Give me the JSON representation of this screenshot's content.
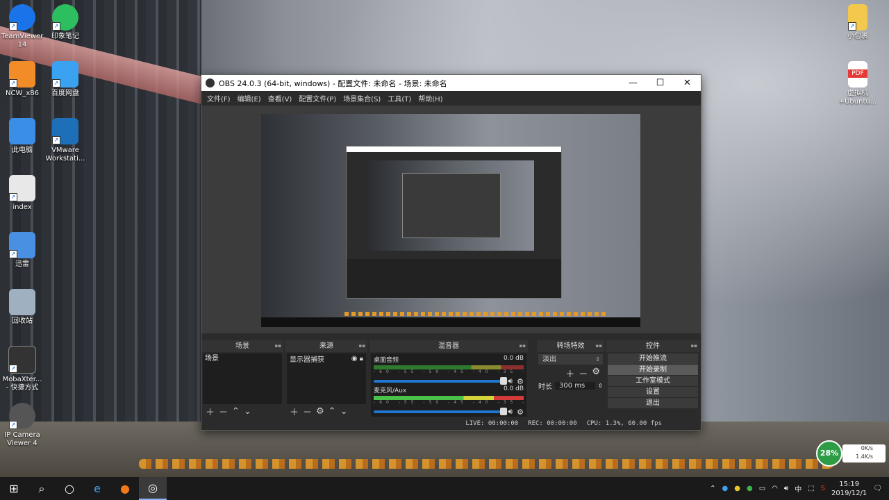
{
  "desktop": {
    "icons_left": [
      {
        "label": "TeamViewer\n14",
        "color": "#1a73e8"
      },
      {
        "label": "NCW_x86",
        "color": "#f28c28"
      },
      {
        "label": "此电脑",
        "color": "#3a8ee6"
      },
      {
        "label": "index",
        "color": "#e8e8e8"
      },
      {
        "label": "迅雷",
        "color": "#4a90e2"
      },
      {
        "label": "回收站",
        "color": "#9fb0c0"
      },
      {
        "label": "MobaXter...\n- 快捷方式",
        "color": "#333333"
      },
      {
        "label": "IP Camera\nViewer 4",
        "color": "#555555"
      }
    ],
    "icons_col2": [
      {
        "label": "印象笔记",
        "color": "#2dbe60"
      },
      {
        "label": "百度网盘",
        "color": "#3aa2f0"
      },
      {
        "label": "VMware\nWorkstati...",
        "color": "#1d6fb8"
      }
    ],
    "icons_right": [
      {
        "label": "小包裹",
        "color": "#f2c94c"
      },
      {
        "label": "虚拟机\n+Ubuntu...",
        "color": "#e53935",
        "badge": "PDF"
      }
    ]
  },
  "obs": {
    "title": "OBS 24.0.3 (64-bit, windows) - 配置文件: 未命名 - 场景: 未命名",
    "window_buttons": {
      "minimize": "—",
      "maximize": "☐",
      "close": "✕"
    },
    "menu": [
      "文件(F)",
      "编辑(E)",
      "查看(V)",
      "配置文件(P)",
      "场景集合(S)",
      "工具(T)",
      "帮助(H)"
    ],
    "docks": {
      "scenes": {
        "title": "场景",
        "items": [
          "场景"
        ]
      },
      "sources": {
        "title": "来源",
        "items": [
          "显示器捕获"
        ]
      },
      "mixer": {
        "title": "混音器",
        "channels": [
          {
            "name": "桌面音频",
            "db": "0.0 dB"
          },
          {
            "name": "麦克风/Aux",
            "db": "0.0 dB"
          }
        ],
        "scale": "-60 -55 -50 -45 -40 -35 -30 -25 -20 -15 -10 -5 0"
      },
      "transitions": {
        "title": "转场特效",
        "selected": "淡出",
        "duration_label": "时长",
        "duration_value": "300 ms"
      },
      "controls": {
        "title": "控件",
        "buttons": [
          "开始推流",
          "开始录制",
          "工作室模式",
          "设置",
          "退出"
        ]
      }
    },
    "status": {
      "live": "LIVE: 00:00:00",
      "rec": "REC: 00:00:00",
      "cpu": "CPU: 1.3%, 60.00 fps"
    }
  },
  "netwidget": {
    "percent": "28%",
    "down": "0K/s",
    "up": "1.4K/s"
  },
  "taskbar": {
    "time": "15:19",
    "date": "2019/12/1",
    "ime": "中"
  }
}
